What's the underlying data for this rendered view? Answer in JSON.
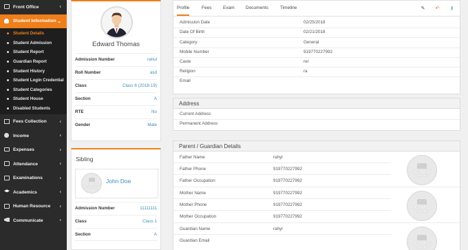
{
  "sidebar": {
    "items": [
      {
        "label": "Front Office",
        "icon": "ipad-icon"
      },
      {
        "label": "Student Information",
        "icon": "user-icon",
        "active": true
      },
      {
        "label": "Fees Collection",
        "icon": "money-icon"
      },
      {
        "label": "Income",
        "icon": "coins-icon"
      },
      {
        "label": "Expenses",
        "icon": "credit-card-icon"
      },
      {
        "label": "Attendance",
        "icon": "calendar-check-icon"
      },
      {
        "label": "Examinations",
        "icon": "map-icon"
      },
      {
        "label": "Academics",
        "icon": "mortarboard-icon"
      },
      {
        "label": "Human Resource",
        "icon": "sitemap-icon"
      },
      {
        "label": "Communicate",
        "icon": "bullhorn-icon"
      }
    ],
    "submenu": [
      "Student Details",
      "Student Admission",
      "Student Report",
      "Guardian Report",
      "Student History",
      "Student Login Credential",
      "Student Categories",
      "Student House",
      "Disabled Students"
    ]
  },
  "profile": {
    "name": "Edward Thomas",
    "fields": [
      {
        "label": "Admission Number",
        "value": "rahul"
      },
      {
        "label": "Roll Number",
        "value": "asd"
      },
      {
        "label": "Class",
        "value": "Class 6 (2018-19)"
      },
      {
        "label": "Section",
        "value": "A"
      },
      {
        "label": "RTE",
        "value": "No"
      },
      {
        "label": "Gender",
        "value": "Male"
      }
    ]
  },
  "sibling": {
    "title": "Sibling",
    "name": "John Doe",
    "no_image_text": "NO IMAGE",
    "no_image_sub": "AVAILABLE",
    "fields": [
      {
        "label": "Admission Number",
        "value": "11111111"
      },
      {
        "label": "Class",
        "value": "Class 1"
      },
      {
        "label": "Section",
        "value": "A"
      }
    ]
  },
  "tabs": [
    "Profile",
    "Fees",
    "Exam",
    "Documents",
    "Timeline"
  ],
  "tools": [
    {
      "icon": "pencil-icon",
      "color": "#444444"
    },
    {
      "icon": "undo-icon",
      "color": "#e05a3a"
    },
    {
      "icon": "key-icon",
      "color": "#2e9b4f"
    }
  ],
  "details": [
    {
      "label": "Admission Date",
      "value": "02/25/2018"
    },
    {
      "label": "Date Of Birth",
      "value": "02/21/2018"
    },
    {
      "label": "Category",
      "value": "General"
    },
    {
      "label": "Mobile Number",
      "value": "919770227992"
    },
    {
      "label": "Caste",
      "value": "rer"
    },
    {
      "label": "Religion",
      "value": "ra"
    },
    {
      "label": "Email",
      "value": ""
    }
  ],
  "address": {
    "title": "Address",
    "rows": [
      {
        "label": "Current Address",
        "value": ""
      },
      {
        "label": "Permanent Address",
        "value": ""
      }
    ]
  },
  "guardian": {
    "title": "Parent / Guardian Details",
    "rows": [
      {
        "label": "Father Name",
        "value": "rahyl"
      },
      {
        "label": "Father Phone",
        "value": "919770227992"
      },
      {
        "label": "Father Occupation",
        "value": "919770227992"
      },
      {
        "label": "Mother Name",
        "value": "919770227992"
      },
      {
        "label": "Mother Phone",
        "value": "919770227992"
      },
      {
        "label": "Mother Occupation",
        "value": "919770227992"
      },
      {
        "label": "Guardian Name",
        "value": "rahyl"
      },
      {
        "label": "Guardian Email",
        "value": ""
      }
    ]
  },
  "colors": {
    "accent": "#ef7f1a",
    "link": "#3c8dbc",
    "sidebar": "#2b2b2b"
  }
}
